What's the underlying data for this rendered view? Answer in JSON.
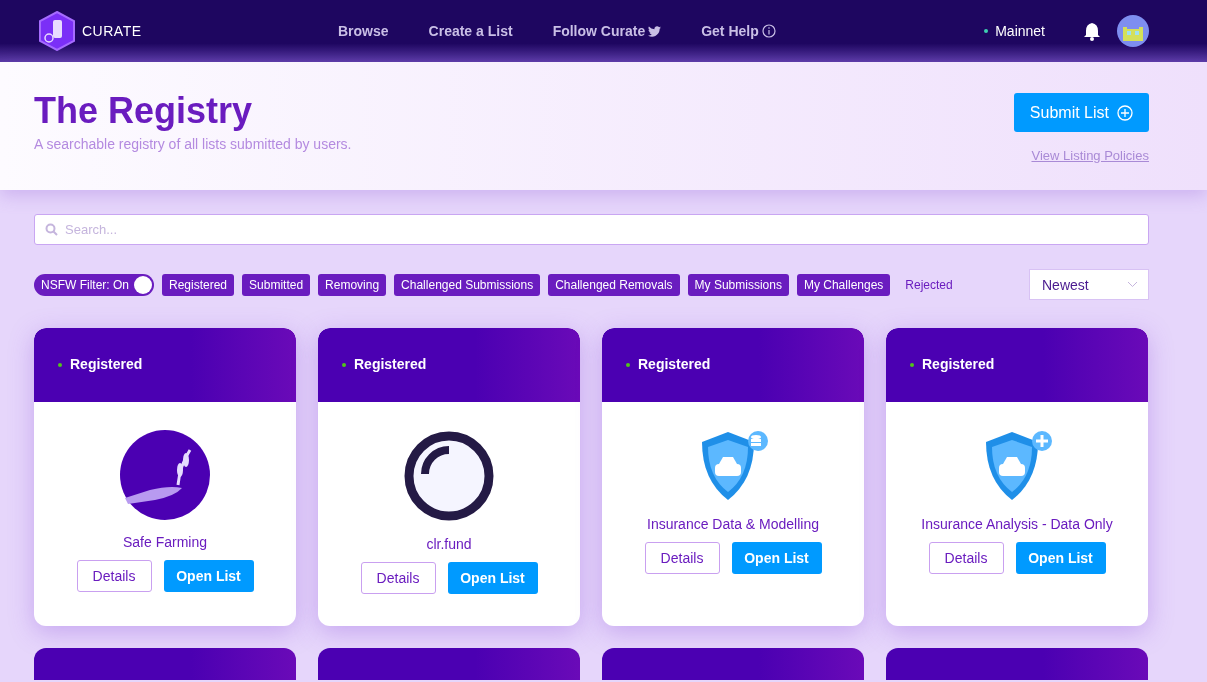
{
  "nav": {
    "brand": "CURATE",
    "links": [
      {
        "label": "Browse"
      },
      {
        "label": "Create a List"
      },
      {
        "label": "Follow Curate"
      },
      {
        "label": "Get Help"
      }
    ],
    "network": "Mainnet"
  },
  "header": {
    "title": "The Registry",
    "subtitle": "A searchable registry of all lists submitted by users.",
    "submit": "Submit List",
    "policies": "View Listing Policies"
  },
  "search": {
    "placeholder": "Search..."
  },
  "filters": {
    "nsfw": {
      "label": "NSFW Filter: On",
      "on": true
    },
    "chips": [
      {
        "label": "Registered",
        "selected": true
      },
      {
        "label": "Submitted",
        "selected": true
      },
      {
        "label": "Removing",
        "selected": true
      },
      {
        "label": "Challenged Submissions",
        "selected": true
      },
      {
        "label": "Challenged Removals",
        "selected": true
      },
      {
        "label": "My Submissions",
        "selected": true
      },
      {
        "label": "My Challenges",
        "selected": true
      },
      {
        "label": "Rejected",
        "selected": false
      }
    ],
    "sort": "Newest"
  },
  "cards": [
    {
      "status": "Registered",
      "kind": "plant",
      "name": "Safe Farming",
      "details": "Details",
      "open": "Open List"
    },
    {
      "status": "Registered",
      "kind": "ring",
      "name": "clr.fund",
      "details": "Details",
      "open": "Open List"
    },
    {
      "status": "Registered",
      "kind": "shield-data",
      "name": "Insurance Data & Modelling",
      "details": "Details",
      "open": "Open List"
    },
    {
      "status": "Registered",
      "kind": "shield-plus",
      "name": "Insurance Analysis - Data Only",
      "details": "Details",
      "open": "Open List"
    }
  ],
  "next_cards": [
    {
      "kind": "header"
    },
    {
      "kind": "header"
    },
    {
      "kind": "header"
    },
    {
      "kind": "header"
    }
  ]
}
